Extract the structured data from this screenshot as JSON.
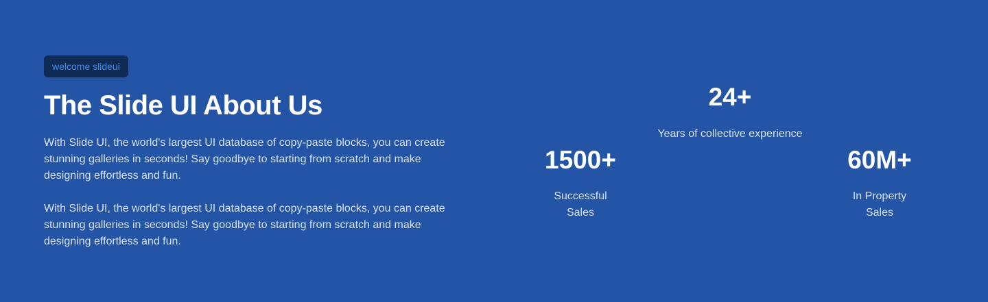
{
  "hero": {
    "badge": "welcome slideui",
    "title": "The Slide UI About Us",
    "paragraphs": [
      "With Slide UI, the world's largest UI database of copy-paste blocks, you can create stunning galleries in seconds! Say goodbye to starting from scratch and make designing effortless and fun.",
      "With Slide UI, the world's largest UI database of copy-paste blocks, you can create stunning galleries in seconds! Say goodbye to starting from scratch and make designing effortless and fun."
    ]
  },
  "stats": [
    {
      "value": "1500+",
      "label": "Successful Sales"
    },
    {
      "value": "24+",
      "label": "Years of collective experience"
    },
    {
      "value": "60M+",
      "label": "In Property Sales"
    }
  ],
  "colors": {
    "background": "#2354a5",
    "badge_bg": "#0f2a55",
    "badge_text": "#3b8ff0",
    "body_text": "#d7e2f6"
  }
}
